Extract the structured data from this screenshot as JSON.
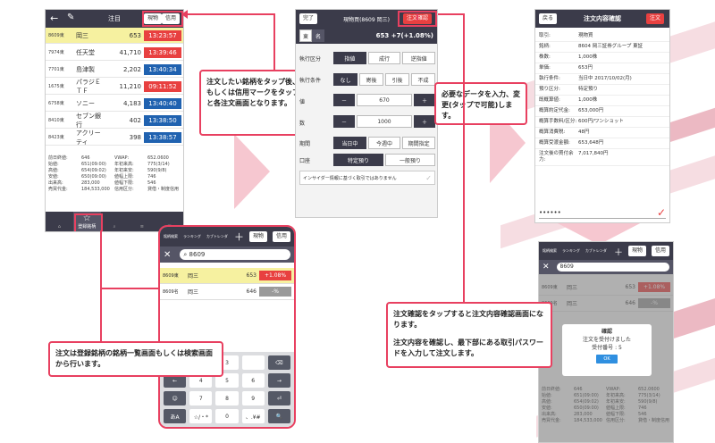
{
  "screen1": {
    "title": "注目",
    "btn_spot": "現物",
    "btn_margin": "信用",
    "rows": [
      {
        "code": "8609東",
        "name": "岡三",
        "price": "653",
        "time": "13:23:57",
        "tc": "#e84040",
        "hl": true
      },
      {
        "code": "7974東",
        "name": "任天堂",
        "price": "41,710",
        "time": "13:39:46",
        "tc": "#e84040",
        "hl": false
      },
      {
        "code": "7701東",
        "name": "島津製",
        "price": "2,202",
        "time": "13:40:34",
        "tc": "#2062b0",
        "hl": false
      },
      {
        "code": "1675東",
        "name": "パラジＥＴＦ",
        "price": "11,210",
        "time": "09:11:52",
        "tc": "#e84040",
        "hl": false
      },
      {
        "code": "6758東",
        "name": "ソニー",
        "price": "4,183",
        "time": "13:40:40",
        "tc": "#2062b0",
        "hl": false
      },
      {
        "code": "8410東",
        "name": "セブン銀行",
        "price": "402",
        "time": "13:38:50",
        "tc": "#2062b0",
        "hl": false
      },
      {
        "code": "8423東",
        "name": "アクリーティ",
        "price": "398",
        "time": "13:38:57",
        "tc": "#2062b0",
        "hl": false
      }
    ],
    "details": [
      [
        "前日終値:",
        "646",
        "VWAP:",
        "652.0600"
      ],
      [
        "始値:",
        "651(09:00)",
        "年初来高:",
        "775(3/14)"
      ],
      [
        "高値:",
        "654(09:02)",
        "年初来安:",
        "590(9/8)"
      ],
      [
        "安値:",
        "650(09:00)",
        "値幅上限:",
        "746"
      ],
      [
        "出来高:",
        "283,000",
        "値幅下限:",
        "546"
      ],
      [
        "売買代金:",
        "184,533,000",
        "信用区分:",
        "貸借・制度信用"
      ]
    ],
    "tabs": [
      "",
      "登録銘柄",
      "",
      "",
      ""
    ]
  },
  "callout1": "注文したい銘柄をタップ後、現物もしくは信用マークをタップすると各注文画面となります。",
  "screen2": {
    "back": "完了",
    "title": "現物買(8609 岡三)",
    "confirm": "注文確認",
    "tab_a": "東",
    "tab_b": "名",
    "quote": "653 +7(+1.08%)",
    "exec_label": "執行区分",
    "exec_opts": [
      "指値",
      "成行",
      "逆指値"
    ],
    "cond_label": "執行条件",
    "cond_opts": [
      "なし",
      "寄後",
      "引後",
      "不成"
    ],
    "price_label": "値",
    "price": "670",
    "qty_label": "数",
    "qty": "1000",
    "period_label": "期間",
    "period_opts": [
      "当日中",
      "今週中",
      "期間指定"
    ],
    "account_label": "口座",
    "account_opts": [
      "特定預り",
      "一般預り"
    ],
    "insider": "インサイダー情報に基づく取引ではありません",
    "minus": "－",
    "plus": "＋"
  },
  "callout2": "必要なデータを入力、変更(タップで可能)します。",
  "screen3": {
    "back": "戻る",
    "title": "注文内容確認",
    "order": "注文",
    "rows": [
      [
        "取引:",
        "現物買"
      ],
      [
        "銘柄:",
        "8604 岡三証券グループ 東証"
      ],
      [
        "株数:",
        "1,000株"
      ],
      [
        "単価:",
        "653円"
      ],
      [
        "執行条件:",
        "当日中 2017/10/02(月)"
      ],
      [
        "預り区分:",
        "特定預り"
      ],
      [
        "既概算値:",
        "1,000株"
      ],
      [
        "概算約定代金:",
        "653,000円"
      ],
      [
        "概算手数料/区分:",
        "600円/ワンショット"
      ],
      [
        "概算消費税:",
        "48円"
      ],
      [
        "概算受渡金額:",
        "653,648円"
      ],
      [
        "注文後の買付余力:",
        "7,017,840円"
      ]
    ],
    "password": "••••••"
  },
  "screen4": {
    "search": "8609",
    "rows": [
      {
        "code": "8609東",
        "name": "岡三",
        "price": "653",
        "chg": "+1.08%",
        "hl": true
      },
      {
        "code": "8609名",
        "name": "岡三",
        "price": "646",
        "chg": "-%",
        "hl": false
      }
    ],
    "header_items": [
      "銘柄検索",
      "ランキング",
      "カブトレンダ"
    ],
    "btn_spot": "現物",
    "btn_margin": "信用",
    "keys": [
      "1",
      "2",
      "3",
      "",
      "⌫",
      "←",
      "4",
      "5",
      "6",
      "→",
      "☺",
      "7",
      "8",
      "9",
      "⏎",
      "あA",
      "☆/・*",
      "0",
      "、.¥#",
      "🔍"
    ]
  },
  "callout3": "注文は登録銘柄の銘柄一覧画面もしくは検索画面から行います。",
  "callout4_1": "注文確認をタップすると注文内容確認画面になります。",
  "callout4_2": "注文内容を確認し、最下部にある取引パスワードを入力して注文します。",
  "screen5": {
    "header_items": [
      "銘柄検索",
      "ランキング",
      "カブトレンダ"
    ],
    "btn_spot": "現物",
    "btn_margin": "信用",
    "search": "8609",
    "rows": [
      {
        "code": "8609東",
        "name": "岡三",
        "price": "653",
        "chg": "+1.08%"
      },
      {
        "code": "8609名",
        "name": "岡三",
        "price": "646",
        "chg": "-%"
      }
    ],
    "dialog_title": "確認",
    "dialog_msg": "注文を受付けました",
    "dialog_num": "受付番号 : 5",
    "dialog_ok": "OK",
    "details": [
      [
        "前日終値:",
        "646",
        "VWAP:",
        "652.0600"
      ],
      [
        "始値:",
        "651(09:00)",
        "年初来高:",
        "775(3/14)"
      ],
      [
        "高値:",
        "654(09:02)",
        "年初来安:",
        "590(9/8)"
      ],
      [
        "安値:",
        "650(09:00)",
        "値幅上限:",
        "746"
      ],
      [
        "出来高:",
        "283,000",
        "値幅下限:",
        "546"
      ],
      [
        "売買代金:",
        "184,533,000",
        "信用区分:",
        "貸借・制度信用"
      ]
    ]
  }
}
